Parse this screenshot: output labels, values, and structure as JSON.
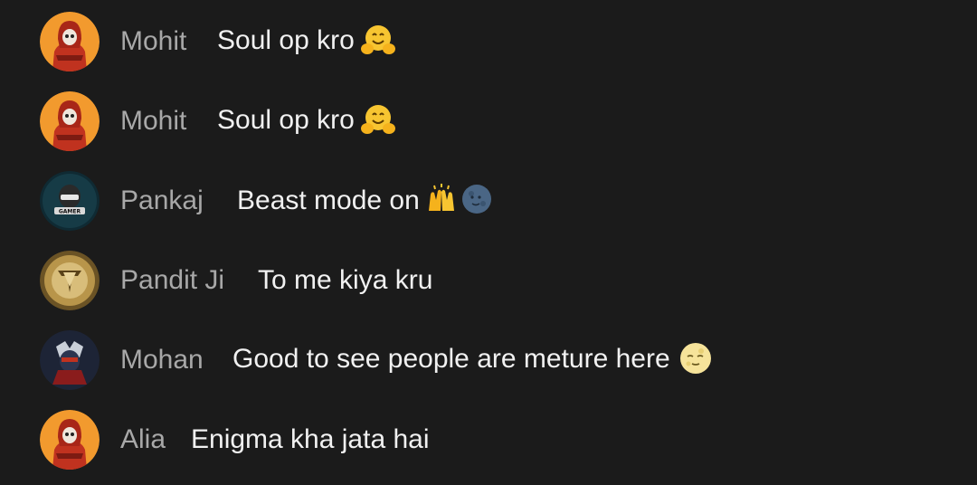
{
  "comments": [
    {
      "author": "Mohit",
      "text": "Soul op kro",
      "emoji": "hugging-face-icon",
      "avatar": "hooded-skull-avatar"
    },
    {
      "author": "Mohit",
      "text": "Soul op kro",
      "emoji": "hugging-face-icon",
      "avatar": "hooded-skull-avatar"
    },
    {
      "author": "Pankaj",
      "text": "Beast mode on",
      "emoji": "raising-hands-icon",
      "emoji2": "new-moon-face-icon",
      "avatar": "gamer-mascot-avatar"
    },
    {
      "author": "Pandit Ji",
      "text": "To me kiya kru",
      "avatar": "gold-logo-avatar"
    },
    {
      "author": "Mohan",
      "text": "Good to see people are meture here",
      "emoji": "full-moon-face-icon",
      "avatar": "masked-ninja-avatar"
    },
    {
      "author": "Alia",
      "text": "Enigma kha jata hai",
      "avatar": "hooded-skull-avatar"
    }
  ],
  "colors": {
    "background": "#1b1b1b",
    "author": "#a8a8a8",
    "message": "#f1f1f1",
    "avatar_orange": "#f29a2e",
    "avatar_red": "#c0321f"
  }
}
